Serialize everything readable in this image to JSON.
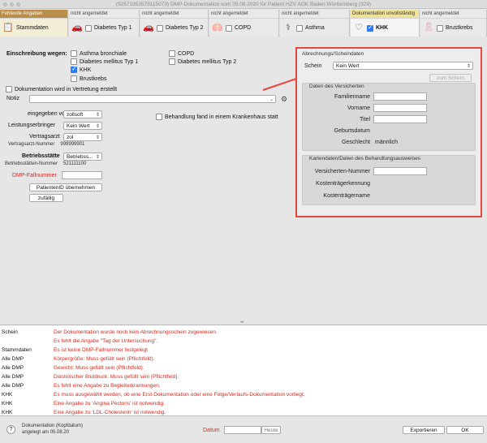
{
  "window": {
    "title": "(92571953578115073) DMP-Dokumentation vom 05.08.2020 für Patient HZV AOK Baden Württemberg (329)"
  },
  "tabs": [
    {
      "status": "Fehlende Angaben",
      "label": "Stammdaten",
      "icon": "clipboard-icon",
      "has_checkbox": false,
      "checked": false
    },
    {
      "status": "nicht angemeldet",
      "label": "Diabetes Typ 1",
      "icon": "car-icon",
      "has_checkbox": true,
      "checked": false
    },
    {
      "status": "nicht angemeldet",
      "label": "Diabetes Typ 2",
      "icon": "car-icon",
      "has_checkbox": true,
      "checked": false
    },
    {
      "status": "nicht angemeldet",
      "label": "COPD",
      "icon": "lungs-icon",
      "has_checkbox": true,
      "checked": false
    },
    {
      "status": "nicht angemeldet",
      "label": "Asthma",
      "icon": "stethoscope-icon",
      "has_checkbox": true,
      "checked": false
    },
    {
      "status": "Dokumentation unvollständig",
      "label": "KHK",
      "icon": "heart-icon",
      "has_checkbox": true,
      "checked": true
    },
    {
      "status": "nicht angemeldet",
      "label": "Brustkrebs",
      "icon": "ribbon-icon",
      "has_checkbox": true,
      "checked": false
    }
  ],
  "form": {
    "einschreibung_label": "Einschreibung wegen:",
    "programs": [
      {
        "label": "Asthma bronchiale",
        "checked": false
      },
      {
        "label": "Diabetes mellitus Typ 1",
        "checked": false
      },
      {
        "label": "KHK",
        "checked": true
      },
      {
        "label": "Brustkrebs",
        "checked": false
      },
      {
        "label": "COPD",
        "checked": false
      },
      {
        "label": "Diabetes mellitus Typ 2",
        "checked": false
      }
    ],
    "vertretung_label": "Dokumentation wird in Vertretung erstellt",
    "notiz_label": "Notiz",
    "eingegeben_von_label": "eingegeben von",
    "eingegeben_von_value": "zollsoft",
    "leistungserbringer_label": "Leistungserbringer",
    "leistungserbringer_value": "Kein Wert",
    "vertragsarzt_label": "Vertragsarzt",
    "vertragsarzt_value": "zol",
    "vertragsarzt_nummer_label": "Vertragsarzt-Nummer",
    "vertragsarzt_nummer_value": "999999901",
    "betriebsstaette_label": "Betriebsstätte",
    "betriebsstaette_value": "Betriebss...",
    "betriebsstaetten_nummer_label": "Betriebsstätten-Nummer",
    "betriebsstaetten_nummer_value": "521111100",
    "krankenhaus_label": "Behandlung fand in einem Krankenhaus statt",
    "dmp_fallnummer_label": "DMP-Fallnummer",
    "patientid_button": "PatientenID übernehmen",
    "zufaellig_button": "zufällig"
  },
  "abrechnung": {
    "title": "Abrechnungs/Scheindaten",
    "schein_label": "Schein",
    "schein_value": "Kein Wert",
    "zum_schein_button": "zum Schein",
    "versicherten_title": "Daten des Versicherten",
    "familienname_label": "Familienname",
    "vorname_label": "Vorname",
    "titel_label": "Titel",
    "geburtsdatum_label": "Geburtsdatum",
    "geschlecht_label": "Geschlecht",
    "geschlecht_value": "männlich",
    "karten_title": "Kartendaten/Daten des Behandlungsausweises",
    "versichertennummer_label": "Versicherten-Nummer",
    "kostentraegerkennung_label": "Kostenträgerkennung",
    "kostentraegername_label": "Kostenträgername"
  },
  "messages": [
    {
      "key": "Schein",
      "text": "Der Dokumentation wurde noch kein Abrechnungsschein zugewiesen."
    },
    {
      "key": "",
      "text": "Es fehlt die Angabe \"Tag der Untersuchung\"."
    },
    {
      "key": "Stammdaten",
      "text": "Es ist keine DMP-Fallnummer festgelegt"
    },
    {
      "key": "Alle DMP",
      "text": "Körpergröße: Muss gefüllt sein (Pflichtfeld)."
    },
    {
      "key": "Alle DMP",
      "text": "Gewicht: Muss gefüllt sein (Pflichtfeld)."
    },
    {
      "key": "Alle DMP",
      "text": "Diastolischer Blutdruck: Muss gefüllt sein (Pflichtfeld)."
    },
    {
      "key": "Alle DMP",
      "text": "Es fehlt eine Angabe zu Begleiterkrankungen."
    },
    {
      "key": "KHK",
      "text": "Es muss ausgewählt werden, ob eine Erst-Dokumentation oder eine Folge/Verlaufs-Dokumentation vorliegt."
    },
    {
      "key": "KHK",
      "text": "Eine Angabe zu 'Angina Pectoris' ist notwendig."
    },
    {
      "key": "KHK",
      "text": "Eine Angabe zu 'LDL-Cholesterin' ist notwendig."
    }
  ],
  "footer": {
    "dokumentation_label": "Dokumentation (Kopfdatum)",
    "angelegt_label": "angelegt am 05.08.20",
    "datum_label": "Datum",
    "heute_button": "Heute",
    "exportieren_button": "Exportieren",
    "ok_button": "OK",
    "help_symbol": "?"
  },
  "colors": {
    "accent": "#2f7cf6",
    "error": "#d8291e",
    "highlight": "#e8483b"
  }
}
